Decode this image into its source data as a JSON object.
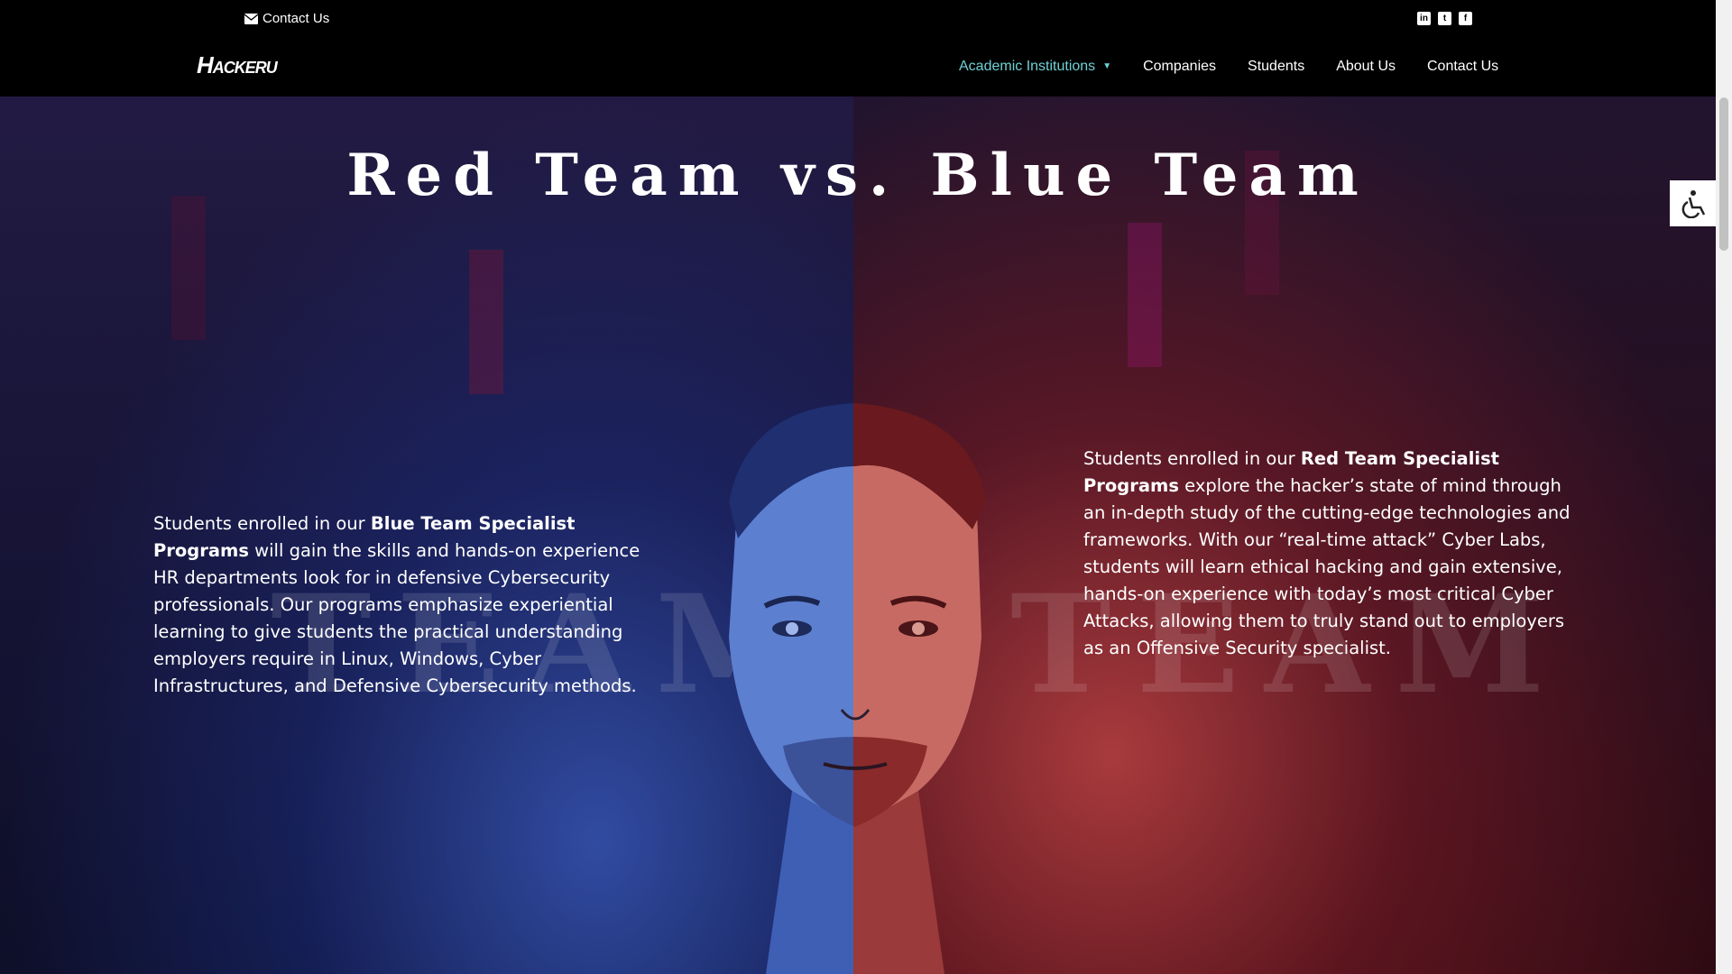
{
  "topbar": {
    "contact_label": "Contact Us",
    "social": [
      {
        "icon": "linkedin-icon",
        "glyph": "in"
      },
      {
        "icon": "twitter-icon",
        "glyph": "t"
      },
      {
        "icon": "facebook-icon",
        "glyph": "f"
      }
    ]
  },
  "nav": {
    "logo_main": "H",
    "logo_rest": "ACKERU",
    "items": [
      {
        "label": "Academic Institutions",
        "active": true,
        "has_dropdown": true
      },
      {
        "label": "Companies"
      },
      {
        "label": "Students"
      },
      {
        "label": "About Us"
      },
      {
        "label": "Contact Us"
      }
    ],
    "active_color": "#6fd1d4"
  },
  "hero": {
    "title": "Red Team vs. Blue Team",
    "blue": {
      "intro": "Students enrolled in our ",
      "bold": "Blue Team Specialist Programs",
      "rest": " will gain the skills and hands-on experience HR departments look for in defensive Cybersecurity professionals. Our programs emphasize experiential learning to give students the practical understanding employers require in Linux, Windows, Cyber Infrastructures, and Defensive Cybersecurity methods."
    },
    "red": {
      "intro": "Students enrolled in our ",
      "bold": "Red Team Specialist Programs",
      "rest": " explore the hacker’s state of mind through an in-depth study of the cutting-edge technologies and frameworks. With our “real-time attack” Cyber Labs, students will learn ethical hacking and gain extensive, hands-on experience with today’s most critical Cyber Attacks, allowing them to truly stand out to employers as an Offensive Security specialist."
    },
    "watermark_blue": "BLUE TEAM",
    "watermark_red": "RED TEAM"
  },
  "accessibility": {
    "icon": "accessibility-icon"
  }
}
